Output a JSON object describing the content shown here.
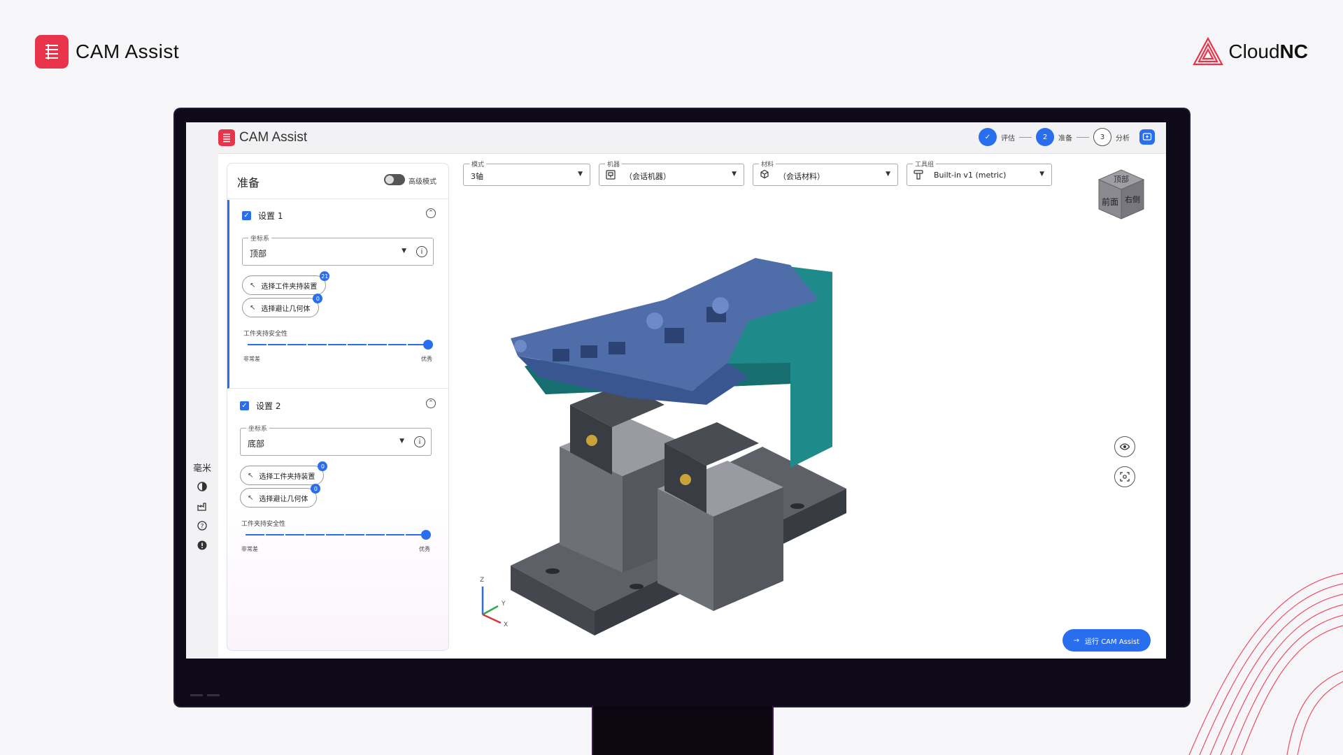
{
  "page": {
    "brand_title": "CAM Assist",
    "partner_prefix": "Cloud",
    "partner_suffix": "NC"
  },
  "app": {
    "title": "CAM Assist",
    "steps": [
      {
        "label": "评估",
        "state": "done",
        "marker": "✓"
      },
      {
        "label": "准备",
        "state": "active",
        "marker": "2"
      },
      {
        "label": "分析",
        "state": "todo",
        "marker": "3"
      }
    ]
  },
  "rail": {
    "unit": "毫米"
  },
  "panel": {
    "title": "准备",
    "advanced_label": "高级模式",
    "advanced_on": false,
    "setups": [
      {
        "name": "设置 1",
        "checked": true,
        "coord_label": "坐标系",
        "coord_value": "顶部",
        "workholding_btn": "选择工件夹持装置",
        "workholding_count": "21",
        "avoid_btn": "选择避让几何体",
        "avoid_count": "0",
        "safety_label": "工件夹持安全性",
        "safety_min": "非常差",
        "safety_max": "优秀",
        "safety_value": 1.0
      },
      {
        "name": "设置 2",
        "checked": true,
        "coord_label": "坐标系",
        "coord_value": "底部",
        "workholding_btn": "选择工件夹持装置",
        "workholding_count": "0",
        "avoid_btn": "选择避让几何体",
        "avoid_count": "0",
        "safety_label": "工件夹持安全性",
        "safety_min": "非常差",
        "safety_max": "优秀",
        "safety_value": 1.0
      }
    ]
  },
  "toolbar": {
    "mode_label": "模式",
    "mode_value": "3轴",
    "machine_label": "机器",
    "machine_value": "（会话机器）",
    "material_label": "材料",
    "material_value": "（会话材料）",
    "toolset_label": "工具组",
    "toolset_value": "Built-in v1 (metric)"
  },
  "viewport": {
    "cube_top": "顶部",
    "cube_front": "前面",
    "cube_right": "右侧",
    "axis_z": "Z",
    "axis_y": "Y",
    "axis_x": "X",
    "run_button": "运行 CAM Assist"
  },
  "colors": {
    "accent": "#2a6ef0",
    "brand_red": "#e8334a",
    "part_blue": "#4f6da8",
    "fixture_teal": "#1f8a8a",
    "vise_gray": "#8c8c92"
  }
}
